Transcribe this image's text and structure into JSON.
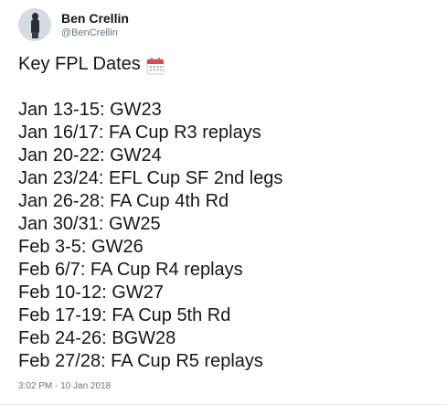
{
  "author": {
    "display_name": "Ben Crellin",
    "handle": "@BenCrellin"
  },
  "tweet": {
    "title": "Key FPL Dates",
    "title_icon": "calendar-icon",
    "lines": [
      "Jan 13-15: GW23",
      "Jan 16/17: FA Cup R3 replays",
      "Jan 20-22: GW24",
      "Jan 23/24: EFL Cup SF 2nd legs",
      "Jan 26-28: FA Cup 4th Rd",
      "Jan 30/31: GW25",
      "Feb 3-5: GW26",
      "Feb 6/7: FA Cup R4 replays",
      "Feb 10-12: GW27",
      "Feb 17-19: FA Cup 5th Rd",
      "Feb 24-26: BGW28",
      "Feb 27/28: FA Cup R5 replays"
    ],
    "timestamp": "3:02 PM - 10 Jan 2018"
  },
  "colors": {
    "text": "#14171a",
    "secondary": "#657786",
    "calendar_red": "#e0474c"
  }
}
